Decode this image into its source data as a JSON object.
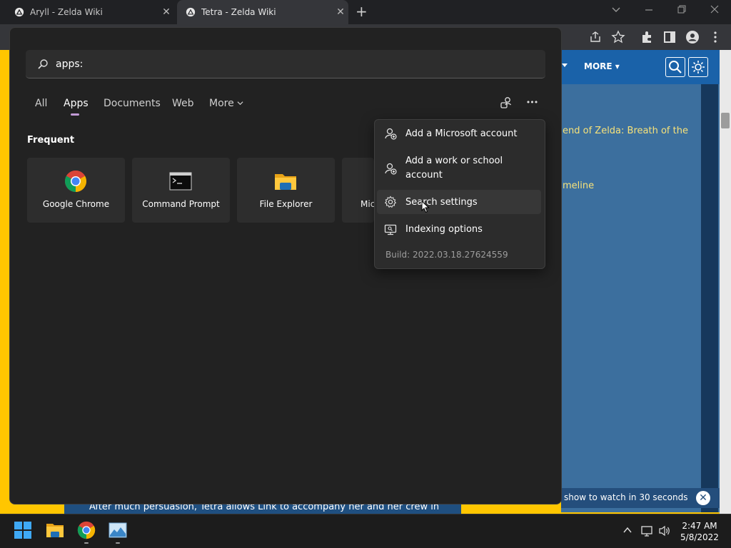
{
  "browser": {
    "tabs": [
      {
        "label": "Aryll - Zelda Wiki",
        "active": false
      },
      {
        "label": "Tetra - Zelda Wiki",
        "active": true
      }
    ],
    "close_glyph": "✕",
    "new_tab_glyph": "+"
  },
  "website": {
    "nav_more": "MORE",
    "links": [
      "end of Zelda: Breath of the",
      "meline"
    ],
    "video_text": "show to watch in 30 seconds",
    "video_close_glyph": "✕",
    "body_text": "After much persuasion, Tetra allows Link to accompany her and her crew in",
    "colors": {
      "yellow": "#ffc600",
      "nav_blue": "#1a62a9",
      "content_blue": "#3c6f9e",
      "link": "#f7e27a"
    }
  },
  "search": {
    "query": "apps:",
    "filter_tabs": [
      {
        "label": "All",
        "active": false
      },
      {
        "label": "Apps",
        "active": true
      },
      {
        "label": "Documents",
        "active": false
      },
      {
        "label": "Web",
        "active": false
      },
      {
        "label": "More",
        "active": false
      }
    ],
    "section_title": "Frequent",
    "apps": [
      {
        "label": "Google Chrome",
        "icon": "chrome-icon"
      },
      {
        "label": "Command Prompt",
        "icon": "terminal-icon"
      },
      {
        "label": "File Explorer",
        "icon": "folder-icon"
      },
      {
        "label": "Mic",
        "icon": "app-icon"
      }
    ],
    "menu": {
      "items": [
        {
          "label": "Add a Microsoft account",
          "icon": "person-add-icon"
        },
        {
          "label": "Add a work or school account",
          "icon": "person-add-icon"
        },
        {
          "label": "Search settings",
          "icon": "gear-icon"
        },
        {
          "label": "Indexing options",
          "icon": "indexing-icon"
        }
      ],
      "build": "Build: 2022.03.18.27624559"
    },
    "more_menu_glyph": "•••",
    "accent": "#c29bd6"
  },
  "taskbar": {
    "time": "2:47 AM",
    "date": "5/8/2022",
    "tray_chevron": "^"
  }
}
